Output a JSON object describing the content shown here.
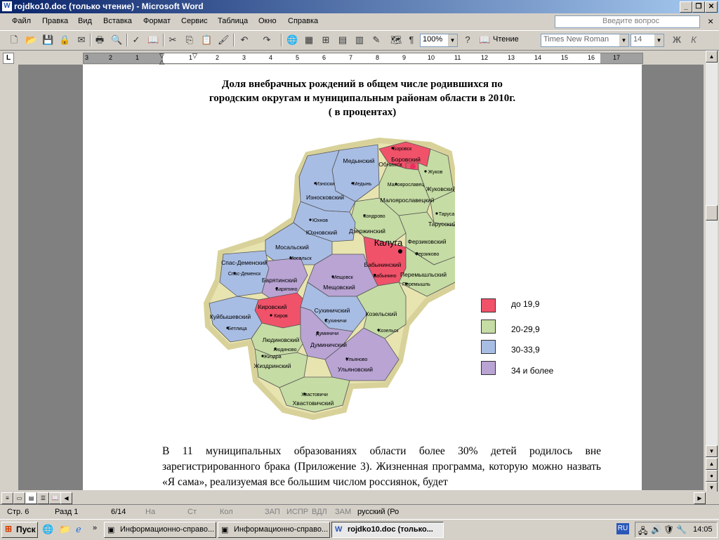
{
  "window": {
    "title": "rojdko10.doc (только чтение) - Microsoft Word",
    "app_icon": "W"
  },
  "menu": {
    "items": [
      "Файл",
      "Правка",
      "Вид",
      "Вставка",
      "Формат",
      "Сервис",
      "Таблица",
      "Окно",
      "Справка"
    ],
    "ask_placeholder": "Введите вопрос",
    "close": "×"
  },
  "toolbar": {
    "zoom": "100%",
    "read_label": "Чтение",
    "font": "Times New Roman",
    "size": "14",
    "bold": "Ж",
    "italic": "К",
    "pilcrow": "¶"
  },
  "ruler": {
    "numbers": [
      "3",
      "2",
      "1",
      "1",
      "2",
      "3",
      "4",
      "5",
      "6",
      "7",
      "8",
      "9",
      "10",
      "11",
      "12",
      "13",
      "14",
      "15",
      "16",
      "17"
    ],
    "corner": "L"
  },
  "document": {
    "title_line1": "Доля внебрачных рождений в  общем числе родившихся по",
    "title_line2": "городским округам и муниципальным районам области в 2010г.",
    "title_line3": "( в процентах)",
    "paragraph": "В 11 муниципальных образованиях области более 30% детей родилось вне зарегистрированного брака (Приложение 3). Жизненная программа, которую можно назвать «Я сама», реализуемая все большим числом россиянок, будет"
  },
  "map": {
    "city_label": "Калуга",
    "districts": [
      {
        "name": "Медынский",
        "town": "Медынь",
        "category": "30-33,9"
      },
      {
        "name": "Износковский",
        "town": "Износки",
        "category": "30-33,9"
      },
      {
        "name": "Боровский",
        "town": "Боровск",
        "category": "до 19,9"
      },
      {
        "name": "Обнинск",
        "town": "",
        "category": "до 19,9"
      },
      {
        "name": "Жуковский",
        "town": "Жуков",
        "category": "20-29,9"
      },
      {
        "name": "Малоярославецкий",
        "town": "Малоярославец",
        "category": "20-29,9"
      },
      {
        "name": "Тарусский",
        "town": "Таруса",
        "category": "20-29,9"
      },
      {
        "name": "Дзержинский",
        "town": "Кондрово",
        "category": "20-29,9"
      },
      {
        "name": "Юхновский",
        "town": "Юхнов",
        "category": "30-33,9"
      },
      {
        "name": "Ферзиковский",
        "town": "Ферзиково",
        "category": "20-29,9"
      },
      {
        "name": "Мосальский",
        "town": "Мосальск",
        "category": "30-33,9"
      },
      {
        "name": "Бабынинский",
        "town": "Бабынино",
        "category": "до 19,9"
      },
      {
        "name": "Перемышльский",
        "town": "Перемышль",
        "category": "20-29,9"
      },
      {
        "name": "Спас-Деменский",
        "town": "Спас-Деменск",
        "category": "30-33,9"
      },
      {
        "name": "Барятинский",
        "town": "Барятино",
        "category": "34 и более"
      },
      {
        "name": "Мещовский",
        "town": "Мещовск",
        "category": "34 и более"
      },
      {
        "name": "Кировский",
        "town": "Киров",
        "category": "до 19,9"
      },
      {
        "name": "Куйбышевский",
        "town": "Бетлица",
        "category": "30-33,9"
      },
      {
        "name": "Сухиничский",
        "town": "Сухиничи",
        "category": "30-33,9"
      },
      {
        "name": "Козельский",
        "town": "Козельск",
        "category": "20-29,9"
      },
      {
        "name": "Людиновский",
        "town": "Людиново",
        "category": "20-29,9"
      },
      {
        "name": "Думиничский",
        "town": "Думиничи",
        "category": "34 и более"
      },
      {
        "name": "Жиздринский",
        "town": "Жиздра",
        "category": "20-29,9"
      },
      {
        "name": "Ульяновский",
        "town": "Ульяново",
        "category": "34 и более"
      },
      {
        "name": "Хвастовичский",
        "town": "Хвастовичи",
        "category": "20-29,9"
      }
    ],
    "legend": [
      {
        "label": "до 19,9",
        "color": "#f0526a"
      },
      {
        "label": "20-29,9",
        "color": "#c5dca4"
      },
      {
        "label": "30-33,9",
        "color": "#a8bde4"
      },
      {
        "label": "34 и более",
        "color": "#b9a4d4"
      }
    ]
  },
  "status": {
    "page": "Стр. 6",
    "section": "Разд 1",
    "pages": "6/14",
    "at": "На",
    "line": "Ст",
    "col": "Кол",
    "rec": "ЗАП",
    "trk": "ИСПР",
    "ext": "ВДЛ",
    "ovr": "ЗАМ",
    "lang": "русский (Ро"
  },
  "taskbar": {
    "start": "Пуск",
    "tasks": [
      "Информационно-справо...",
      "Информационно-справо...",
      "rojdko10.doc (только..."
    ],
    "lang": "RU",
    "clock": "14:05"
  }
}
